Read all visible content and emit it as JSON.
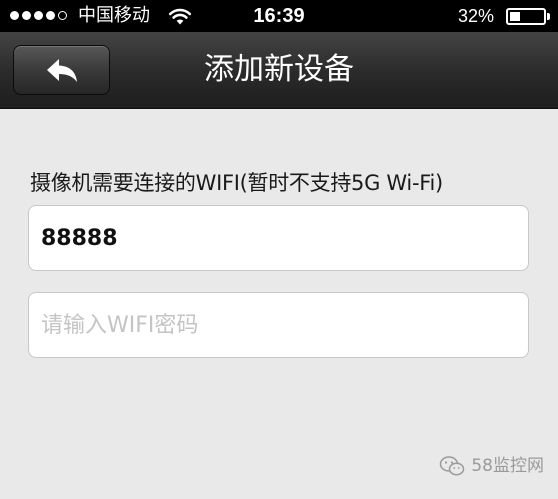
{
  "status_bar": {
    "signal_bars_filled": 4,
    "signal_bars_total": 5,
    "carrier": "中国移动",
    "wifi_icon": "wifi-icon",
    "time": "16:39",
    "battery_percent": "32%",
    "battery_level": 0.32
  },
  "nav": {
    "back_icon": "back-arrow-icon",
    "title": "添加新设备"
  },
  "form": {
    "label": "摄像机需要连接的WIFI(暂时不支持5G Wi-Fi)",
    "ssid_value": "88888",
    "password_placeholder": "请输入WIFI密码",
    "password_value": ""
  },
  "watermark": {
    "icon": "wechat-logo-icon",
    "text": "58监控网"
  },
  "colors": {
    "background": "#e9e9e9",
    "nav_bar": "#2c2c2c",
    "status_bar": "#000000",
    "placeholder": "#c4c4c4"
  }
}
